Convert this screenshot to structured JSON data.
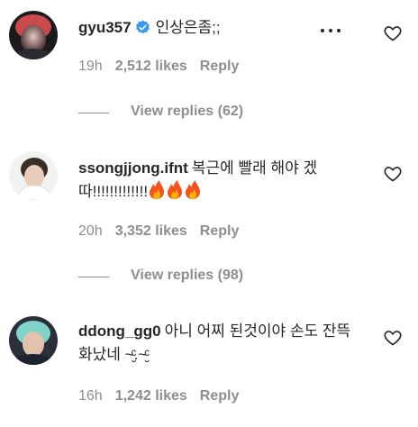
{
  "comments": [
    {
      "username": "gyu357",
      "verified": true,
      "text": "인상은좀;;",
      "time": "19h",
      "likes": "2,512 likes",
      "reply_label": "Reply",
      "view_replies": "View replies (62)"
    },
    {
      "username": "ssongjjong.ifnt",
      "verified": false,
      "text": "복근에 빨래 해야 겠따!!!!!!!!!!!!!",
      "emoji": "🔥🔥🔥",
      "time": "20h",
      "likes": "3,352 likes",
      "reply_label": "Reply",
      "view_replies": "View replies (98)"
    },
    {
      "username": "ddong_gg0",
      "verified": false,
      "text": "아니 어찌 된것이야 손도 잔뜩 화났네 ~̮ͨ.~̮ͨ",
      "time": "16h",
      "likes": "1,242 likes",
      "reply_label": "Reply"
    }
  ],
  "colors": {
    "text": "#262626",
    "muted": "#8e8e8e",
    "verified": "#3897f0",
    "flame": "#f4511e"
  },
  "icons": [
    "verified-badge-icon",
    "heart-icon",
    "more-options-icon",
    "fire-emoji-icon"
  ]
}
